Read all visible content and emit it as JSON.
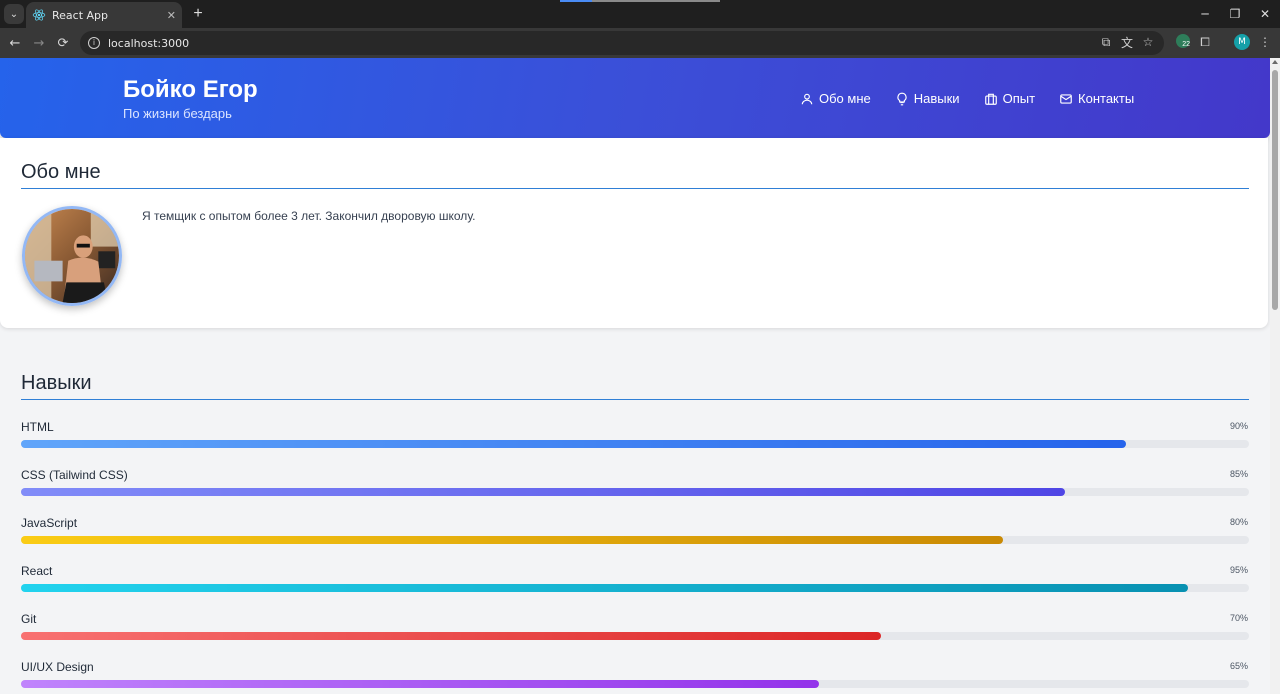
{
  "browser": {
    "tab_title": "React App",
    "tab_close": "✕",
    "new_tab": "+",
    "url": "localhost:3000",
    "profile_initial": "M",
    "extension_badge": "22",
    "window_controls": {
      "minimize": "─",
      "restore": "❐",
      "close": "✕"
    },
    "nav": {
      "back": "←",
      "forward": "→",
      "reload": "⟳"
    }
  },
  "header": {
    "name": "Бойко Егор",
    "tagline": "По жизни бездарь",
    "nav": [
      {
        "label": "Обо мне",
        "icon": "user-icon"
      },
      {
        "label": "Навыки",
        "icon": "lightbulb-icon"
      },
      {
        "label": "Опыт",
        "icon": "briefcase-icon"
      },
      {
        "label": "Контакты",
        "icon": "mail-icon"
      }
    ]
  },
  "about": {
    "title": "Обо мне",
    "text": "Я темщик с опытом более 3 лет. Закончил дворовую школу."
  },
  "skills": {
    "title": "Навыки",
    "items": [
      {
        "name": "HTML",
        "percent_label": "90%",
        "value": 90,
        "color_from": "#60a5fa",
        "color_to": "#2563eb"
      },
      {
        "name": "CSS (Tailwind CSS)",
        "percent_label": "85%",
        "value": 85,
        "color_from": "#818cf8",
        "color_to": "#4f46e5"
      },
      {
        "name": "JavaScript",
        "percent_label": "80%",
        "value": 80,
        "color_from": "#facc15",
        "color_to": "#ca8a04"
      },
      {
        "name": "React",
        "percent_label": "95%",
        "value": 95,
        "color_from": "#22d3ee",
        "color_to": "#0891b2"
      },
      {
        "name": "Git",
        "percent_label": "70%",
        "value": 70,
        "color_from": "#f87171",
        "color_to": "#dc2626"
      },
      {
        "name": "UI/UX Design",
        "percent_label": "65%",
        "value": 65,
        "color_from": "#c084fc",
        "color_to": "#9333ea"
      }
    ]
  }
}
